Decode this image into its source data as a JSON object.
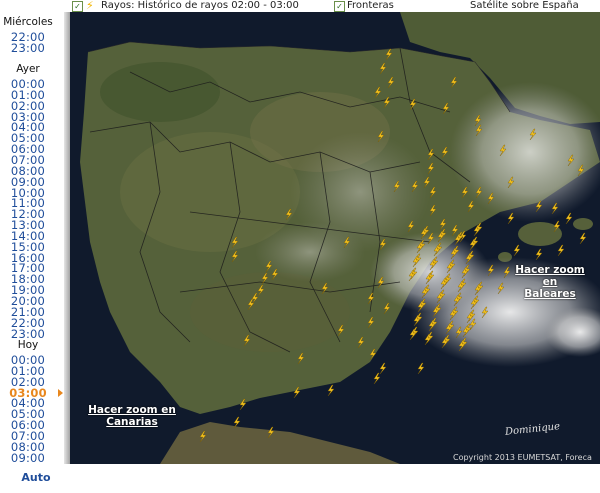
{
  "topbar": {
    "rayos_label": "Rayos: Histórico de rayos 02:00 - 03:00",
    "fronteras_label": "Fronteras",
    "satellite_label": "Satélite sobre España"
  },
  "sidebar": {
    "today_prev_label": "Miércoles",
    "today_prev_times": [
      "22:00",
      "23:00"
    ],
    "ayer_label": "Ayer",
    "ayer_times": [
      "00:00",
      "01:00",
      "02:00",
      "03:00",
      "04:00",
      "05:00",
      "06:00",
      "07:00",
      "08:00",
      "09:00",
      "10:00",
      "11:00",
      "12:00",
      "13:00",
      "14:00",
      "15:00",
      "16:00",
      "17:00",
      "18:00",
      "19:00",
      "20:00",
      "21:00",
      "22:00",
      "23:00"
    ],
    "hoy_label": "Hoy",
    "hoy_times": [
      "00:00",
      "01:00",
      "02:00",
      "03:00",
      "04:00",
      "05:00",
      "06:00",
      "07:00",
      "08:00",
      "09:00"
    ],
    "active_time": "03:00",
    "auto_label": "Auto"
  },
  "map": {
    "zoom_baleares_line1": "Hacer zoom en",
    "zoom_baleares_line2": "Baleares",
    "zoom_canarias_line1": "Hacer zoom en",
    "zoom_canarias_line2": "Canarias",
    "signature": "Dominique",
    "copyright": "Copyright 2013 EUMETSAT, Foreca",
    "colors": {
      "sea": "#101a2c",
      "land": "#55613a",
      "lightning": "#f4c21f"
    }
  }
}
